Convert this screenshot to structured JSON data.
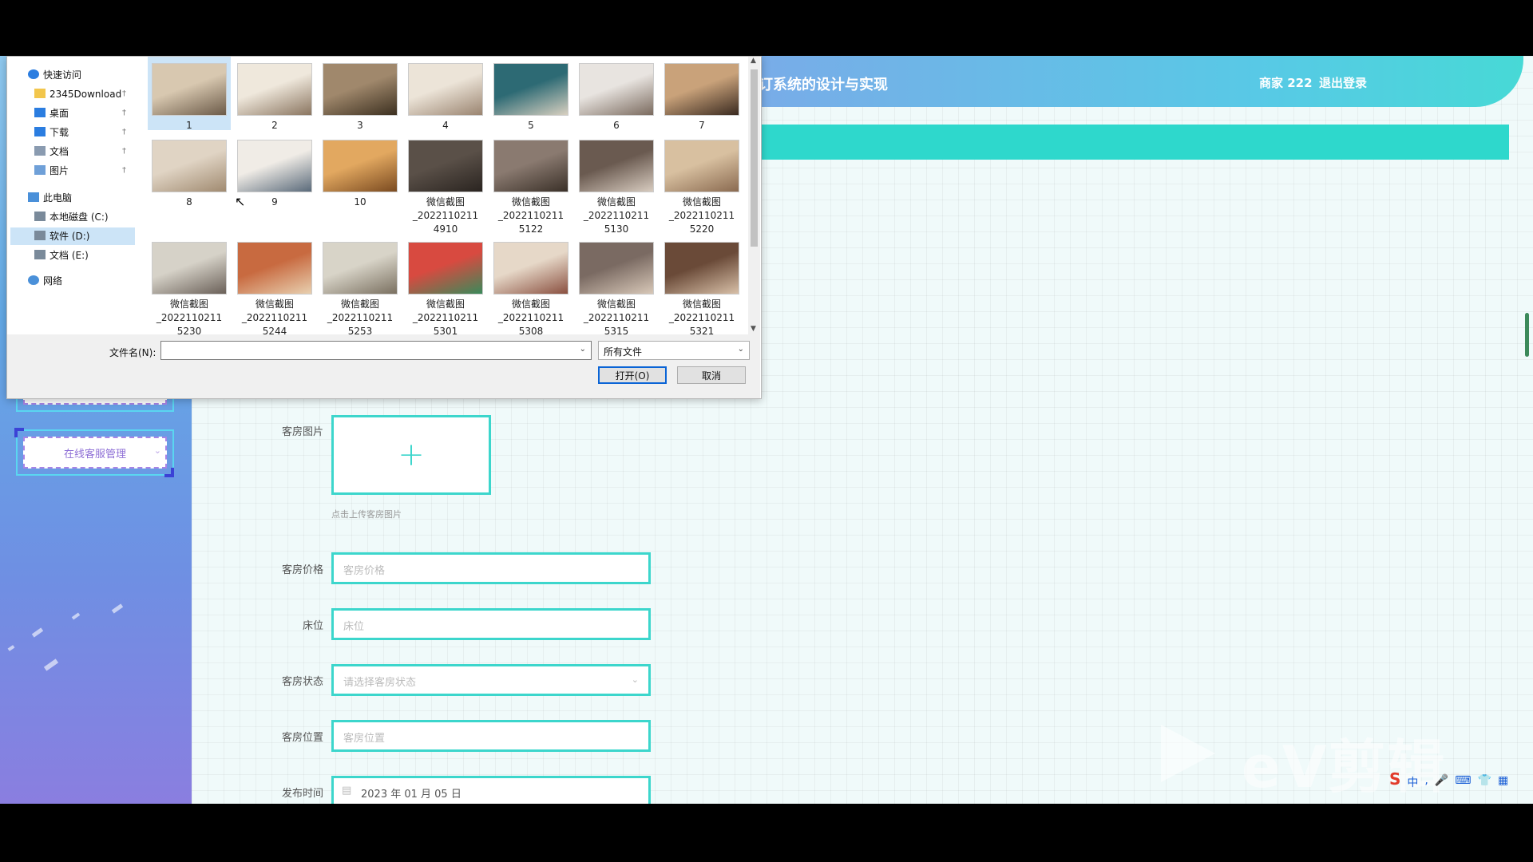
{
  "app": {
    "header": {
      "title": "订系统的设计与实现",
      "user": "商家 222",
      "logout": "退出登录"
    },
    "sidebar": {
      "menu_label": "在线客服管理"
    },
    "form": {
      "room_image_label": "客房图片",
      "room_image_hint": "点击上传客房图片",
      "price_label": "客房价格",
      "price_placeholder": "客房价格",
      "bed_label": "床位",
      "bed_placeholder": "床位",
      "status_label": "客房状态",
      "status_placeholder": "请选择客房状态",
      "location_label": "客房位置",
      "location_placeholder": "客房位置",
      "publish_label": "发布时间",
      "publish_value": "2023 年 01 月 05 日"
    },
    "watermark": "eV剪辑",
    "colors": {
      "accent": "#3cd6cc",
      "header_start": "#9a84e0",
      "header_end": "#47d9d6",
      "sidebar_menu": "#8e6fd6"
    }
  },
  "dialog": {
    "nav": [
      {
        "label": "快速访问",
        "icon": "star-icon"
      },
      {
        "label": "2345Download",
        "icon": "folder-icon",
        "pinned": true
      },
      {
        "label": "桌面",
        "icon": "desktop-icon",
        "pinned": true
      },
      {
        "label": "下载",
        "icon": "download-icon",
        "pinned": true
      },
      {
        "label": "文档",
        "icon": "document-icon",
        "pinned": true
      },
      {
        "label": "图片",
        "icon": "pictures-icon",
        "pinned": true
      },
      {
        "label": "此电脑",
        "icon": "computer-icon"
      },
      {
        "label": "本地磁盘 (C:)",
        "icon": "drive-icon"
      },
      {
        "label": "软件 (D:)",
        "icon": "drive-icon",
        "selected": true
      },
      {
        "label": "文档 (E:)",
        "icon": "drive-icon"
      },
      {
        "label": "网络",
        "icon": "network-icon"
      }
    ],
    "files": [
      {
        "label": "1",
        "selected": true
      },
      {
        "label": "2"
      },
      {
        "label": "3"
      },
      {
        "label": "4"
      },
      {
        "label": "5"
      },
      {
        "label": "6"
      },
      {
        "label": "7"
      },
      {
        "label": "8"
      },
      {
        "label": "9"
      },
      {
        "label": "10"
      },
      {
        "label": "微信截图\n_2022110211\n4910"
      },
      {
        "label": "微信截图\n_2022110211\n5122"
      },
      {
        "label": "微信截图\n_2022110211\n5130"
      },
      {
        "label": "微信截图\n_2022110211\n5220"
      },
      {
        "label": "微信截图\n_2022110211\n5230"
      },
      {
        "label": "微信截图\n_2022110211\n5244"
      },
      {
        "label": "微信截图\n_2022110211\n5253"
      },
      {
        "label": "微信截图\n_2022110211\n5301"
      },
      {
        "label": "微信截图\n_2022110211\n5308"
      },
      {
        "label": "微信截图\n_2022110211\n5315"
      },
      {
        "label": "微信截图\n_2022110211\n5321"
      }
    ],
    "filename_label": "文件名(N):",
    "filename_value": "",
    "filetype_value": "所有文件",
    "open_label": "打开(O)",
    "cancel_label": "取消"
  }
}
